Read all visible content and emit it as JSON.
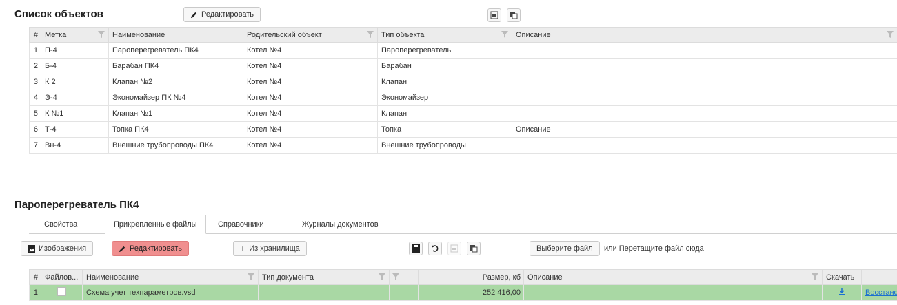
{
  "objects": {
    "title": "Список объектов",
    "edit_label": "Редактировать",
    "columns": [
      "#",
      "Метка",
      "Наименование",
      "Родительский объект",
      "Тип объекта",
      "Описание"
    ],
    "rows": [
      {
        "n": "1",
        "mark": "П-4",
        "name": "Пароперегреватель ПК4",
        "parent": "Котел №4",
        "type": "Пароперегреватель",
        "desc": ""
      },
      {
        "n": "2",
        "mark": "Б-4",
        "name": "Барабан ПК4",
        "parent": "Котел №4",
        "type": "Барабан",
        "desc": ""
      },
      {
        "n": "3",
        "mark": "К 2",
        "name": "Клапан №2",
        "parent": "Котел №4",
        "type": "Клапан",
        "desc": ""
      },
      {
        "n": "4",
        "mark": "Э-4",
        "name": "Экономайзер ПК №4",
        "parent": "Котел №4",
        "type": "Экономайзер",
        "desc": ""
      },
      {
        "n": "5",
        "mark": "К №1",
        "name": "Клапан №1",
        "parent": "Котел №4",
        "type": "Клапан",
        "desc": ""
      },
      {
        "n": "6",
        "mark": "Т-4",
        "name": "Топка ПК4",
        "parent": "Котел №4",
        "type": "Топка",
        "desc": "Описание"
      },
      {
        "n": "7",
        "mark": "Вн-4",
        "name": "Внешние трубопроводы ПК4",
        "parent": "Котел №4",
        "type": "Внешние трубопроводы",
        "desc": ""
      }
    ]
  },
  "detail": {
    "title": "Пароперегреватель ПК4",
    "tabs": [
      "Свойства",
      "Прикрепленные файлы",
      "Справочники",
      "Журналы документов"
    ],
    "active_tab": 1,
    "toolbar": {
      "images_label": "Изображения",
      "edit_label": "Редактировать",
      "storage_label": "Из хранилища",
      "choose_file_label": "Выберите файл",
      "drop_hint": "или Перетащите файл сюда"
    },
    "files": {
      "columns": [
        "#",
        "Файлов...",
        "Наименование",
        "Тип документа",
        "",
        "Размер, кб",
        "Описание",
        "Скачать",
        ""
      ],
      "rows": [
        {
          "n": "1",
          "name": "Схема учет техпараметров.vsd",
          "doctype": "",
          "size": "252 416,00",
          "desc": "",
          "restore": "Восстановить"
        }
      ]
    }
  },
  "colors": {
    "accent_danger": "#f08f8f",
    "selected_row": "#a9d8a4",
    "link": "#1a6fd1",
    "header_bg": "#ececec"
  }
}
